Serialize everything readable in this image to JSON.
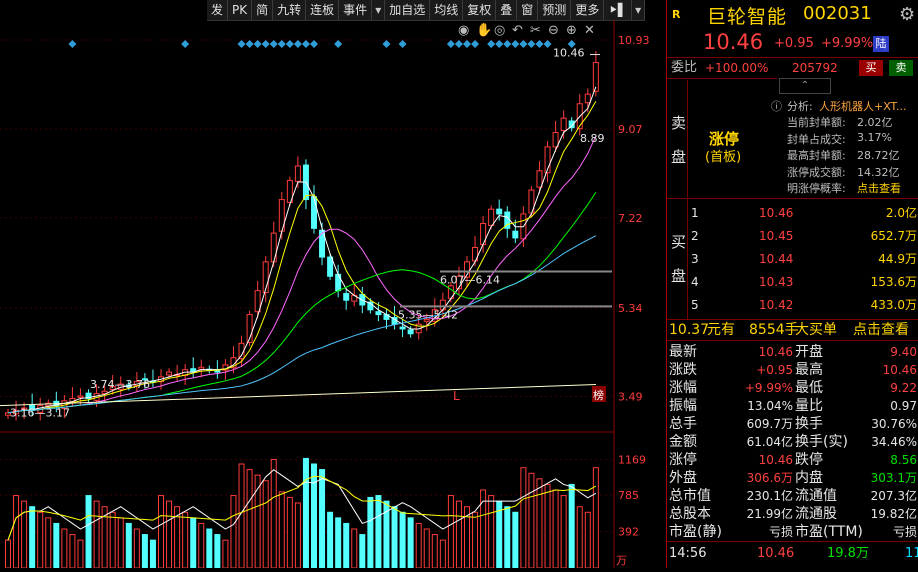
{
  "toolbar": {
    "items": [
      "发",
      "PK",
      "简",
      "九转",
      "连板",
      "事件",
      "▾",
      "加自选",
      "均线",
      "复权",
      "叠",
      "窗",
      "预测",
      "更多",
      "⯈▌",
      "▾"
    ]
  },
  "chart_icons": [
    "eye-icon",
    "hand-icon",
    "target-icon",
    "arrow-left-icon",
    "scissors-icon",
    "zoom-out-icon",
    "zoom-in-icon",
    "close-icon"
  ],
  "price_axis": [
    "10.93",
    "9.07",
    "7.22",
    "5.34",
    "3.49"
  ],
  "volume_axis": [
    "1169",
    "785",
    "392",
    "万"
  ],
  "annotations": {
    "high": "10.46",
    "ma_a": "8.89",
    "ma_b": "6.07—6.14",
    "ma_c": "5.35—5.42",
    "ma_d": "3.74—3.76",
    "ma_e": "3.16—3.17",
    "mark_l": "L",
    "mark_bang": "榜"
  },
  "header": {
    "badge": "R",
    "name": "巨轮智能",
    "code": "002031",
    "price": "10.46",
    "change": "+0.95",
    "change_pct": "+9.99%",
    "tag": "陆",
    "settings_icon": "gear-icon"
  },
  "weibi": {
    "label": "委比",
    "value": "+100.00%",
    "diff": "205792",
    "buy_btn": "买",
    "sell_btn": "卖"
  },
  "sell_block": {
    "side_label": [
      "卖",
      "盘"
    ],
    "limit_title": "涨停",
    "limit_sub": "(首板)",
    "analysis_label": "分析:",
    "analysis_text": "人形机器人+XT...",
    "rows": [
      {
        "k": "当前封单额:",
        "v": "2.02亿"
      },
      {
        "k": "封单占成交:",
        "v": "3.17%"
      },
      {
        "k": "最高封单额:",
        "v": "28.72亿"
      },
      {
        "k": "涨停成交额:",
        "v": "14.32亿"
      },
      {
        "k": "明涨停概率:",
        "v": "点击查看"
      }
    ]
  },
  "buy_block": {
    "side_label": [
      "买",
      "盘"
    ],
    "rows": [
      {
        "n": "1",
        "price": "10.46",
        "vol": "2.0亿"
      },
      {
        "n": "2",
        "price": "10.45",
        "vol": "652.7万"
      },
      {
        "n": "3",
        "price": "10.44",
        "vol": "44.9万"
      },
      {
        "n": "4",
        "price": "10.43",
        "vol": "153.6万"
      },
      {
        "n": "5",
        "price": "10.42",
        "vol": "433.0万"
      }
    ]
  },
  "big_order": {
    "price": "10.37",
    "unit": "元有",
    "qty": "8554手",
    "kind": "大买单",
    "link": "点击查看"
  },
  "stats": [
    {
      "k1": "最新",
      "v1": "10.46",
      "c1": "red",
      "k2": "开盘",
      "v2": "9.40",
      "c2": "red"
    },
    {
      "k1": "涨跌",
      "v1": "+0.95",
      "c1": "red",
      "k2": "最高",
      "v2": "10.46",
      "c2": "red"
    },
    {
      "k1": "涨幅",
      "v1": "+9.99%",
      "c1": "red",
      "k2": "最低",
      "v2": "9.22",
      "c2": "red"
    },
    {
      "k1": "振幅",
      "v1": "13.04%",
      "c1": "white",
      "k2": "量比",
      "v2": "0.97",
      "c2": "white"
    },
    {
      "k1": "总手",
      "v1": "609.7万",
      "c1": "white",
      "k2": "换手",
      "v2": "30.76%",
      "c2": "white"
    },
    {
      "k1": "金额",
      "v1": "61.04亿",
      "c1": "white",
      "k2": "换手(实)",
      "v2": "34.46%",
      "c2": "white"
    },
    {
      "k1": "涨停",
      "v1": "10.46",
      "c1": "red",
      "k2": "跌停",
      "v2": "8.56",
      "c2": "green"
    },
    {
      "k1": "外盘",
      "v1": "306.6万",
      "c1": "red",
      "k2": "内盘",
      "v2": "303.1万",
      "c2": "green"
    },
    {
      "k1": "总市值",
      "v1": "230.1亿",
      "c1": "white",
      "k2": "流通值",
      "v2": "207.3亿",
      "c2": "white"
    },
    {
      "k1": "总股本",
      "v1": "21.99亿",
      "c1": "white",
      "k2": "流通股",
      "v2": "19.82亿",
      "c2": "white"
    },
    {
      "k1": "市盈(静)",
      "v1": "亏损",
      "c1": "white",
      "k2": "市盈(TTM)",
      "v2": "亏损",
      "c2": "white"
    }
  ],
  "tick": {
    "time": "14:56",
    "price": "10.46",
    "vol": "19.8万",
    "extra": "11"
  },
  "colors": {
    "up": "#ff3b3b",
    "down": "#54ffff",
    "ma1": "#ffffff",
    "ma2": "#ffff00",
    "ma3": "#ff66ff",
    "ma4": "#00ff00",
    "ma5": "#4fc3ff",
    "ma6": "#ffffcc"
  }
}
